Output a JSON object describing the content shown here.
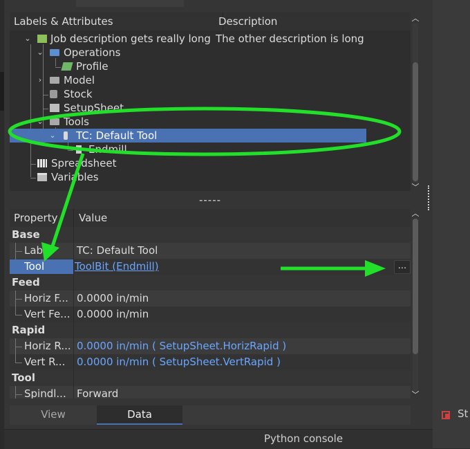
{
  "tree": {
    "columns": [
      "Labels & Attributes",
      "Description"
    ],
    "rows": [
      {
        "label": "Job description gets really long",
        "desc": "The other description is long"
      },
      {
        "label": "Operations"
      },
      {
        "label": "Profile"
      },
      {
        "label": "Model"
      },
      {
        "label": "Stock"
      },
      {
        "label": "SetupSheet"
      },
      {
        "label": "Tools"
      },
      {
        "label": "TC: Default Tool"
      },
      {
        "label": "Endmill"
      },
      {
        "label": "Spreadsheet"
      },
      {
        "label": "Variables"
      }
    ]
  },
  "splitter": "-----",
  "props": {
    "columns": [
      "Property",
      "Value"
    ],
    "groups": {
      "base": "Base",
      "feed": "Feed",
      "rapid": "Rapid",
      "tool": "Tool"
    },
    "rows": {
      "label": {
        "name": "Label",
        "value": "TC: Default Tool"
      },
      "tool": {
        "name": "Tool",
        "value": "ToolBit (Endmill)"
      },
      "horiz_feed": {
        "name": "Horiz F...",
        "value": "0.0000 in/min"
      },
      "vert_feed": {
        "name": "Vert Fe...",
        "value": "0.0000 in/min"
      },
      "horiz_rapid": {
        "name": "Horiz R...",
        "value": "0.0000 in/min  ( SetupSheet.HorizRapid )"
      },
      "vert_rapid": {
        "name": "Vert R...",
        "value": "0.0000 in/min  ( SetupSheet.VertRapid )"
      },
      "spindle": {
        "name": "Spindl...",
        "value": "Forward"
      }
    },
    "dots_label": "..."
  },
  "tabs": [
    "View",
    "Data"
  ],
  "console": "Python console",
  "side_label": "St",
  "colors": {
    "selection": "#4a72b2",
    "annotation": "#22e02a",
    "link": "#6aa6ff"
  },
  "icons": [
    "expand-arrow-icon",
    "job-icon",
    "folder-icon",
    "profile-icon",
    "stock-icon",
    "setupsheet-icon",
    "toolbit-icon",
    "spreadsheet-icon",
    "variables-icon"
  ]
}
